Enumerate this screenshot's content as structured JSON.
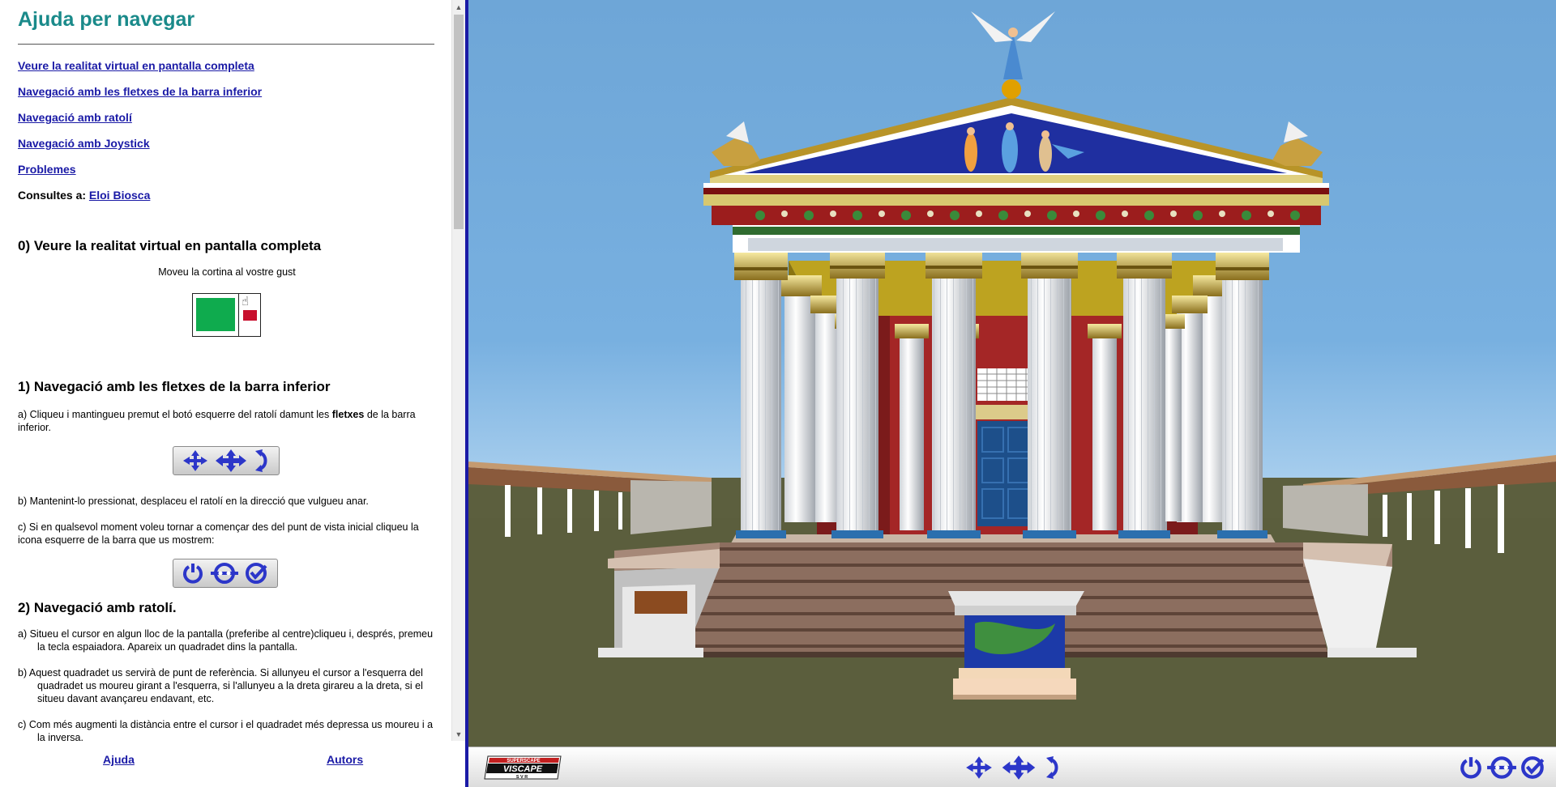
{
  "help": {
    "title": "Ajuda per navegar",
    "toc": [
      {
        "label": "Veure la realitat virtual en pantalla completa"
      },
      {
        "label": "Navegació amb les fletxes de la barra inferior"
      },
      {
        "label": "Navegació amb ratolí"
      },
      {
        "label": "Navegació amb Joystick"
      },
      {
        "label": "Problemes"
      }
    ],
    "contact_label": "Consultes a:",
    "contact_name": "Eloi Biosca",
    "section0": {
      "heading": "0) Veure la realitat virtual en pantalla completa",
      "text": "Moveu la cortina al vostre gust"
    },
    "section1": {
      "heading": "1) Navegació amb les fletxes de la barra inferior",
      "a_prefix": "a) Cliqueu i mantingueu premut el botó esquerre del ratolí damunt les ",
      "a_bold": "fletxes",
      "a_suffix": " de la barra inferior.",
      "b": "b) Mantenint-lo pressionat, desplaceu el ratolí en la direcció que vulgueu anar.",
      "c": "c) Si en qualsevol moment voleu tornar a començar des del punt de vista inicial cliqueu la icona esquerre de la barra que us mostrem:"
    },
    "section2": {
      "heading": "2) Navegació amb ratolí.",
      "a": "a) Situeu el cursor en algun lloc de la pantalla (preferibe al centre)cliqueu i, després, premeu la tecla espaiadora. Apareix un quadradet dins la pantalla.",
      "b": "b) Aquest quadradet us servirà de punt de referència.  Si allunyeu el cursor a l'esquerra del quadradet us moureu girant a l'esquerra, si l'allunyeu a la dreta girareu a la dreta, si el situeu davant avançareu endavant, etc.",
      "c": "c) Com més augmenti la distància entre el cursor i el quadradet més depressa us moureu i a la inversa."
    },
    "footer": {
      "help_link": "Ajuda",
      "authors_link": "Autors"
    }
  },
  "viewer": {
    "logo_top": "SUPERSCAPE",
    "logo_main": "VISCAPE",
    "logo_sub": "S V R",
    "sky_color": "#6fa8d8",
    "ground_color": "#5c5f3e",
    "toolbar_icons": [
      "move-icon",
      "walk-icon",
      "rotate-icon",
      "reset-view-icon",
      "previous-view-icon",
      "next-view-icon"
    ]
  }
}
